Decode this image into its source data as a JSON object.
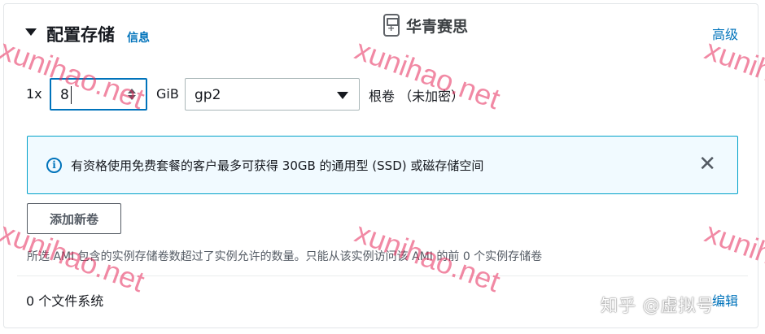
{
  "header": {
    "title": "配置存储",
    "info_link": "信息",
    "advanced_link": "高级",
    "brand_name": "华青赛思"
  },
  "volume_row": {
    "count": "1x",
    "size_value": "8",
    "unit": "GiB",
    "volume_type": "gp2",
    "description": "根卷 （未加密）"
  },
  "alert": {
    "message": "有资格使用免费套餐的客户最多可获得 30GB 的通用型 (SSD) 或磁存储空间",
    "icon": "info-icon",
    "close_icon": "close-icon"
  },
  "add_volume_button": "添加新卷",
  "warning": "所选 AMI 包含的实例存储卷数超过了实例允许的数量。只能从该实例访问该 AMI 的前 0 个实例存储卷",
  "file_systems": {
    "count_text": "0 个文件系统",
    "edit_link": "编辑"
  },
  "watermarks": {
    "site": "xunihao.net",
    "zhihu": "知乎 @虚拟号"
  },
  "colors": {
    "link": "#0073bb",
    "focus_border": "#0073bb",
    "alert_border": "#00a1c9",
    "alert_background": "#f1faff",
    "watermark": "#e6285a"
  }
}
